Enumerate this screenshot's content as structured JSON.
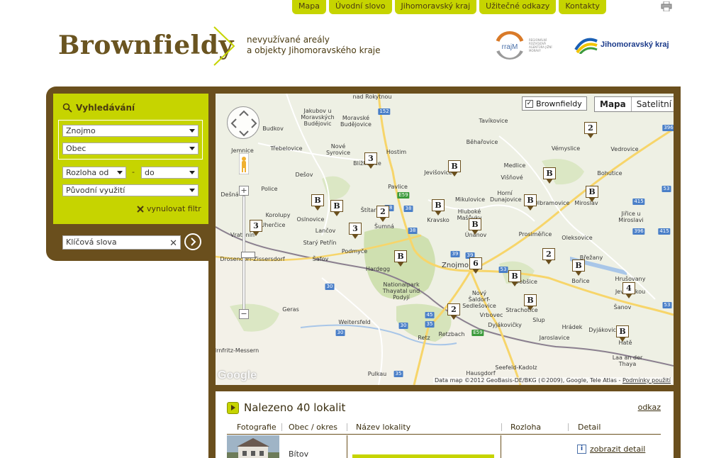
{
  "nav": {
    "items": [
      "Mapa",
      "Úvodní slovo",
      "Jihomoravský kraj",
      "Užitečné odkazy",
      "Kontakty"
    ]
  },
  "header": {
    "logo": "Brownfieldy",
    "tagline_line1": "nevyužívané areály",
    "tagline_line2": "a objekty Jihomoravského kraje",
    "partner1_abbr": "rrajM",
    "partner1_text": "REGIONÁLNÍ ROZVOJOVÁ AGENTURA JIŽNÍ MORAVY",
    "partner2": "Jihomoravský kraj"
  },
  "search": {
    "title": "Vyhledávání",
    "district": "Znojmo",
    "municipality": "Obec",
    "area_from": "Rozloha od",
    "area_separator": "-",
    "area_to": "do",
    "original_use": "Původní využití",
    "reset_label": "vynulovat filtr",
    "keywords_placeholder": "Klíčová slova"
  },
  "map": {
    "layer_label": "Brownfieldy",
    "layer_checked": "✓",
    "type_map": "Mapa",
    "type_satellite": "Satelitní",
    "google": "Google",
    "attribution": "Data map ©2012 GeoBasis-DE/BKG (©2009), Google, Tele Atlas -",
    "terms": "Podmínky použití",
    "zoom_in": "+",
    "zoom_out": "−",
    "markers": [
      "2",
      "3",
      "B",
      "B",
      "B",
      "B",
      "B",
      "B",
      "2",
      "B",
      "B",
      "3",
      "3",
      "B",
      "2",
      "B",
      "6",
      "B",
      "B",
      "B",
      "4",
      "2",
      "B"
    ],
    "places": [
      "nad Rokytnou",
      "Jakubov u Moravských Budějovic",
      "Moravské Budějovice",
      "Budkov",
      "Třebelovice",
      "Nové Syrovice",
      "Jemnice",
      "Blížkovice",
      "Hostim",
      "Dešov",
      "Police",
      "Pavlice",
      "Jevišovice",
      "Běhařovice",
      "Medlice",
      "Višňové",
      "Tavíkovice",
      "Vémyslice",
      "Vedrovice",
      "Bohutice",
      "Horní Dunajovice",
      "Olbramovice",
      "Miroslav",
      "Dešná",
      "Korolupy",
      "Uherčice",
      "Oslnovice",
      "Lančov",
      "Vratěnín",
      "Starý Petřín",
      "Podmyče",
      "Šafov",
      "Štítary",
      "Šumná",
      "Kravsko",
      "Hluboké Mašůvky",
      "Mikulovice",
      "Únanov",
      "Prosiměřice",
      "Oleksovice",
      "Jiřice u Miroslavi",
      "Drosendorf-Zissersdorf",
      "Hardegg",
      "Nationalpark Thayatal und Podyjí",
      "Znojmo",
      "Dobšice",
      "Bořice",
      "Břežany",
      "Hrušovany nad Jevišovkou",
      "Šanov",
      "Geras",
      "Weitersfeld",
      "Nový Šaldorf-Sedlešovice",
      "Vrbovec",
      "Strachotice",
      "Slup",
      "Dyjákovičky",
      "Hrádek",
      "Jaroslavice",
      "Dyjákovice",
      "Hatě",
      "Laa an der Thaya",
      "Retzbach",
      "Retz",
      "Seefeld-Kadolz",
      "Irnfritz-Messern",
      "Hausgdorf",
      "Pulkau"
    ],
    "roads": [
      "152",
      "38",
      "E59",
      "38",
      "38",
      "39",
      "53",
      "53",
      "415",
      "415",
      "30",
      "30",
      "30",
      "35",
      "35",
      "45",
      "E59",
      "53",
      "396",
      "396",
      "39"
    ]
  },
  "results": {
    "title": "Nalezeno 40 lokalit",
    "hide_label": "odkaz",
    "columns": [
      "Fotografie",
      "Obec / okres",
      "Název lokality",
      "Rozloha",
      "Detail"
    ],
    "rows": [
      {
        "obec": "Bítov",
        "detail": "zobrazit detail"
      }
    ]
  }
}
